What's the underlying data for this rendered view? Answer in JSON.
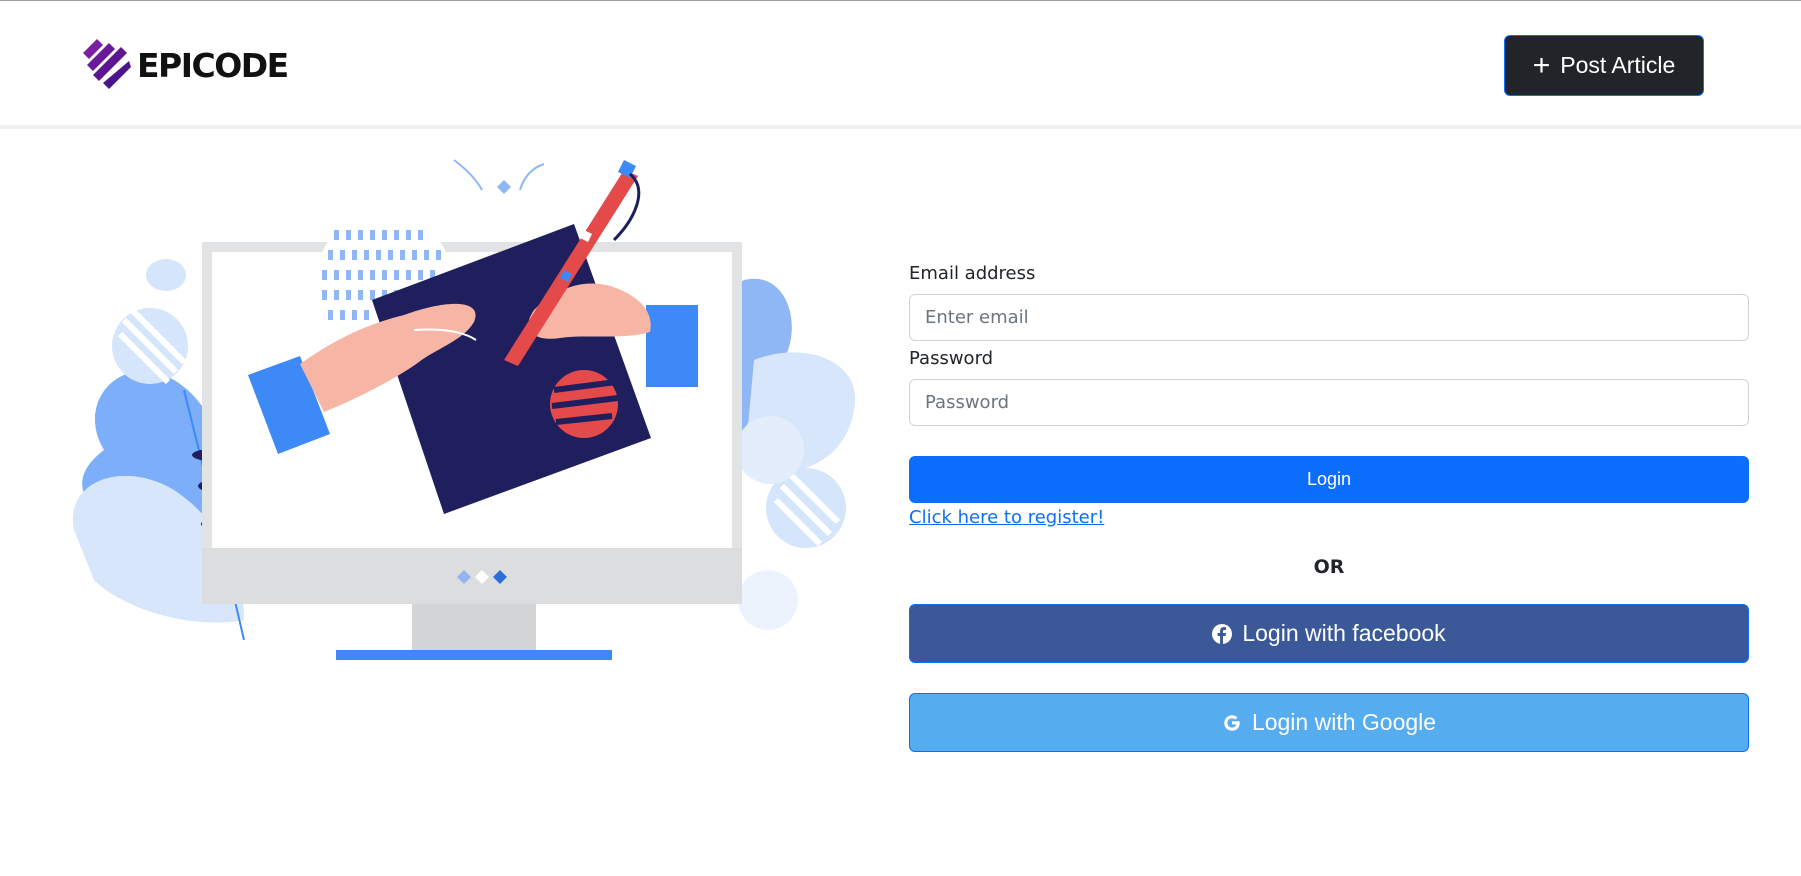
{
  "navbar": {
    "brand": "EPICODE",
    "post_button_label": "Post Article",
    "post_button_icon": "plus-icon"
  },
  "form": {
    "email_label": "Email address",
    "email_placeholder": "Enter email",
    "email_value": "",
    "password_label": "Password",
    "password_placeholder": "Password",
    "password_value": "",
    "login_label": "Login",
    "register_link": "Click here to register!",
    "or_text": "OR",
    "facebook_label": "Login with facebook",
    "google_label": "Login with Google"
  },
  "colors": {
    "primary": "#0d6efd",
    "dark": "#212529",
    "facebook": "#3b5998",
    "google": "#55acee",
    "illustration_navy": "#1f1f5e",
    "illustration_blue": "#3d8af7",
    "illustration_red": "#e44a4a"
  }
}
